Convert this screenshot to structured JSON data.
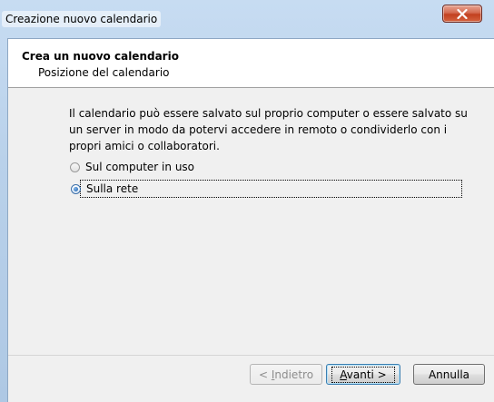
{
  "window": {
    "title": "Creazione nuovo calendario"
  },
  "header": {
    "title": "Crea un nuovo calendario",
    "subtitle": "Posizione del calendario"
  },
  "body": {
    "description": "Il calendario può essere salvato sul proprio computer o essere salvato su un server in modo da potervi accedere in remoto o condividerlo con i propri amici o collaboratori."
  },
  "options": [
    {
      "label": "Sul computer in uso",
      "selected": false
    },
    {
      "label": "Sulla rete",
      "selected": true
    }
  ],
  "buttons": {
    "back_prefix": "< ",
    "back_accel": "I",
    "back_rest": "ndietro",
    "next_accel": "A",
    "next_rest": "vanti >",
    "cancel": "Annulla"
  },
  "icons": {
    "close": "close-icon"
  },
  "colors": {
    "close_button": "#c7402a",
    "accent": "#3c7fb1"
  }
}
